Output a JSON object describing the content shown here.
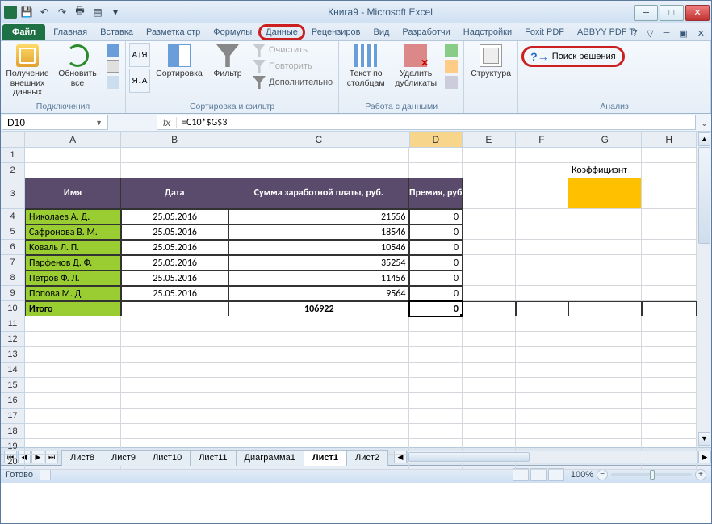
{
  "title": "Книга9 - Microsoft Excel",
  "qat_items": [
    "save",
    "undo",
    "redo",
    "print",
    "open"
  ],
  "win": {
    "min": "─",
    "max": "□",
    "close": "✕"
  },
  "tabs": {
    "file": "Файл",
    "list": [
      "Главная",
      "Вставка",
      "Разметка стр",
      "Формулы",
      "Данные",
      "Рецензиров",
      "Вид",
      "Разработчи",
      "Надстройки",
      "Foxit PDF",
      "ABBYY PDF Tr"
    ],
    "active_index": 4,
    "highlighted_index": 4
  },
  "help_ctl": {
    "help": "?",
    "minrib": "▽",
    "wmin": "─",
    "wmax": "▣",
    "wclose": "✕"
  },
  "ribbon": {
    "groups": {
      "connections": {
        "label": "Подключения",
        "get_ext": "Получение\nвнешних данных",
        "refresh": "Обновить\nвсе"
      },
      "sortfilter": {
        "label": "Сортировка и фильтр",
        "az": "А↓Я",
        "za": "Я↓А",
        "sort": "Сортировка",
        "filter": "Фильтр",
        "clear": "Очистить",
        "reapply": "Повторить",
        "advanced": "Дополнительно"
      },
      "datatools": {
        "label": "Работа с данными",
        "t2c": "Текст по\nстолбцам",
        "dup": "Удалить\nдубликаты"
      },
      "outline": {
        "label": "",
        "struct": "Структура"
      },
      "analysis": {
        "label": "Анализ",
        "solver": "Поиск решения"
      }
    }
  },
  "namebox": "D10",
  "formula": "=C10*$G$3",
  "columns": [
    "A",
    "B",
    "C",
    "D",
    "E",
    "F",
    "G",
    "H"
  ],
  "selected_col_index": 3,
  "coef_label": "Коэффициэнт",
  "headers": {
    "name": "Имя",
    "date": "Дата",
    "salary": "Сумма заработной платы, руб.",
    "bonus": "Премия, руб"
  },
  "rows": [
    {
      "name": "Николаев А. Д.",
      "date": "25.05.2016",
      "salary": "21556",
      "bonus": "0"
    },
    {
      "name": "Сафронова В. М.",
      "date": "25.05.2016",
      "salary": "18546",
      "bonus": "0"
    },
    {
      "name": "Коваль Л. П.",
      "date": "25.05.2016",
      "salary": "10546",
      "bonus": "0"
    },
    {
      "name": "Парфенов Д. Ф.",
      "date": "25.05.2016",
      "salary": "35254",
      "bonus": "0"
    },
    {
      "name": "Петров Ф. Л.",
      "date": "25.05.2016",
      "salary": "11456",
      "bonus": "0"
    },
    {
      "name": "Попова М. Д.",
      "date": "25.05.2016",
      "salary": "9564",
      "bonus": "0"
    }
  ],
  "total": {
    "label": "Итого",
    "salary": "106922",
    "bonus": "0"
  },
  "sheets": [
    "Лист8",
    "Лист9",
    "Лист10",
    "Лист11",
    "Диаграмма1",
    "Лист1",
    "Лист2"
  ],
  "active_sheet_index": 5,
  "status": {
    "ready": "Готово",
    "zoom": "100%"
  }
}
